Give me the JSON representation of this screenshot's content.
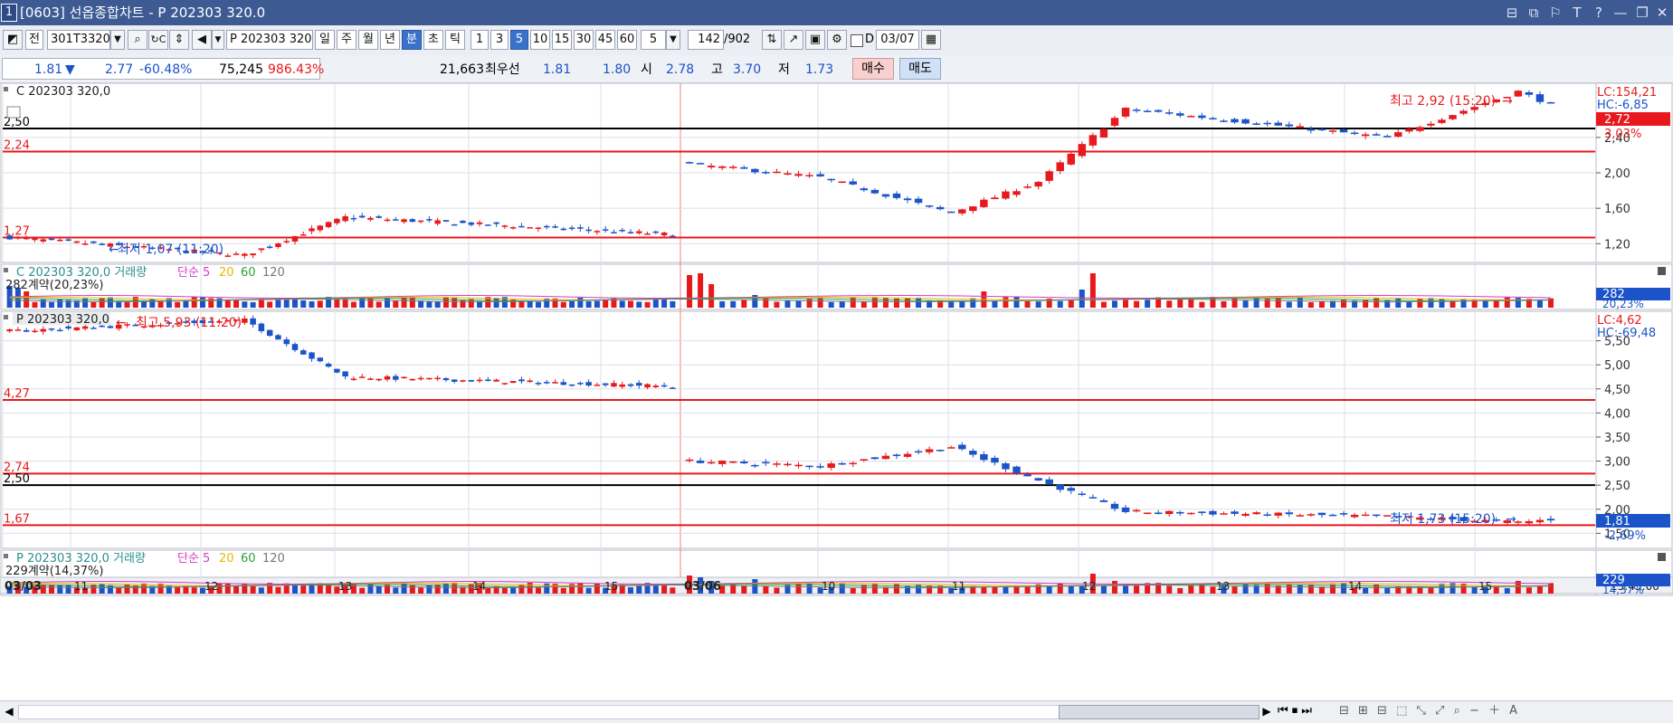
{
  "window": {
    "number": "1",
    "title": "[0603] 선옵종합차트 - P 202303 320.0",
    "controls": [
      "⊟",
      "⧉",
      "⚐",
      "T",
      "?",
      "—",
      "❐",
      "✕"
    ]
  },
  "toolbar": {
    "prev_label": "전",
    "code_value": "301T3320",
    "instrument_value": "P 202303 320",
    "periods": [
      "일",
      "주",
      "월",
      "년",
      "분",
      "초",
      "틱"
    ],
    "active_period": "분",
    "intervals": [
      "1",
      "3",
      "5",
      "10",
      "15",
      "30",
      "45",
      "60"
    ],
    "active_interval": "5",
    "interval_select": "5",
    "count_value": "142",
    "count_total": "/902",
    "d_label": "D",
    "date_value": "03/07"
  },
  "quote": {
    "price": "1.81",
    "arrow": "▼",
    "change": "2.77",
    "change_pct": "-60.48%",
    "volume": "75,245",
    "volume_pct": "986.43%",
    "open_interest": "21,663",
    "best_label": "최우선",
    "bid": "1.81",
    "ask": "1.80",
    "open_label": "시",
    "open": "2.78",
    "high_label": "고",
    "high": "3.70",
    "low_label": "저",
    "low": "1.73",
    "buy_button": "매수",
    "sell_button": "매도"
  },
  "panels": {
    "call_price": {
      "legend": "C 202303 320,0",
      "lc": "LC:154,21",
      "hc": "HC:-6,85",
      "last_value": "2,72",
      "last_pct": "3,03%",
      "y_ticks": [
        "2,40",
        "2,00",
        "1,60",
        "1,20"
      ],
      "hlines": [
        {
          "label": "2,50",
          "value": 2.5,
          "color": "#000000"
        },
        {
          "label": "2,24",
          "value": 2.24,
          "color": "#e8191c"
        },
        {
          "label": "1,27",
          "value": 1.27,
          "color": "#e8191c"
        }
      ],
      "high_note": "최고 2,92 (15:20)",
      "low_note": "최저 1,07 (11:20)"
    },
    "call_volume": {
      "legend_prefix": "C 202303 320,0 거래량",
      "ma_labels": [
        "단순 5",
        "20",
        "60",
        "120"
      ],
      "ma_colors": [
        "#d23cc8",
        "#e6b800",
        "#2e9e3a",
        "#777777"
      ],
      "sub_label": "282계약(20,23%)",
      "right_value": "282",
      "right_pct": "20,23%"
    },
    "put_price": {
      "legend": "P 202303 320,0",
      "lc": "LC:4,62",
      "hc": "HC:-69,48",
      "last_value": "1,81",
      "last_pct": "-2,69%",
      "y_ticks": [
        "5,50",
        "5,00",
        "4,50",
        "4,00",
        "3,50",
        "3,00",
        "2,50",
        "2,00",
        "1,50"
      ],
      "hlines": [
        {
          "label": "4,27",
          "value": 4.27,
          "color": "#e8191c"
        },
        {
          "label": "2,74",
          "value": 2.74,
          "color": "#e8191c"
        },
        {
          "label": "2,50",
          "value": 2.5,
          "color": "#000000"
        },
        {
          "label": "1,67",
          "value": 1.67,
          "color": "#e8191c"
        }
      ],
      "high_note": "최고 5,93 (11:20)",
      "low_note": "최저 1,73 (15:20)"
    },
    "put_volume": {
      "legend_prefix": "P 202303 320,0 거래량",
      "ma_labels": [
        "단순 5",
        "20",
        "60",
        "120"
      ],
      "ma_colors": [
        "#d23cc8",
        "#e6b800",
        "#2e9e3a",
        "#777777"
      ],
      "sub_label": "229계약(14,37%)",
      "right_value": "229",
      "right_pct": "14,37%"
    }
  },
  "x_axis": {
    "labels": [
      "03/03",
      "11",
      "12",
      "13",
      "14",
      "15",
      "03/06",
      "10",
      "11",
      "12",
      "13",
      "14",
      "15"
    ],
    "time_label": "15:45:00"
  },
  "colors": {
    "up": "#e8191c",
    "down": "#1b53c9",
    "ref_red": "#e8191c",
    "ref_black": "#000000",
    "grid": "#dcdfe6",
    "session_divider": "#f08080"
  },
  "chart_data": [
    {
      "type": "candlestick",
      "title": "C 202303 320,0",
      "ylim": [
        1.05,
        2.95
      ],
      "sessions": [
        "03/03",
        "03/06"
      ],
      "keypoints_03_03": [
        {
          "time": "09:00",
          "value": 1.27
        },
        {
          "time": "11:20",
          "value": 1.07
        },
        {
          "time": "12:20",
          "value": 1.5
        },
        {
          "time": "15:40",
          "value": 1.3
        }
      ],
      "keypoints_03_06": [
        {
          "time": "09:00",
          "value": 2.1
        },
        {
          "time": "10:00",
          "value": 1.95
        },
        {
          "time": "11:00",
          "value": 1.55
        },
        {
          "time": "11:40",
          "value": 1.9
        },
        {
          "time": "12:20",
          "value": 2.72
        },
        {
          "time": "14:20",
          "value": 2.4
        },
        {
          "time": "15:20",
          "value": 2.92
        },
        {
          "time": "15:40",
          "value": 2.72
        }
      ]
    },
    {
      "type": "candlestick",
      "title": "P 202303 320,0",
      "ylim": [
        1.3,
        6.0
      ],
      "sessions": [
        "03/03",
        "03/06"
      ],
      "keypoints_03_03": [
        {
          "time": "09:00",
          "value": 5.7
        },
        {
          "time": "11:20",
          "value": 5.93
        },
        {
          "time": "12:20",
          "value": 4.75
        },
        {
          "time": "15:40",
          "value": 4.55
        }
      ],
      "keypoints_03_06": [
        {
          "time": "09:00",
          "value": 3.0
        },
        {
          "time": "10:00",
          "value": 2.9
        },
        {
          "time": "11:00",
          "value": 3.3
        },
        {
          "time": "11:40",
          "value": 2.6
        },
        {
          "time": "12:20",
          "value": 1.95
        },
        {
          "time": "14:20",
          "value": 1.85
        },
        {
          "time": "15:20",
          "value": 1.73
        },
        {
          "time": "15:40",
          "value": 1.81
        }
      ]
    }
  ]
}
